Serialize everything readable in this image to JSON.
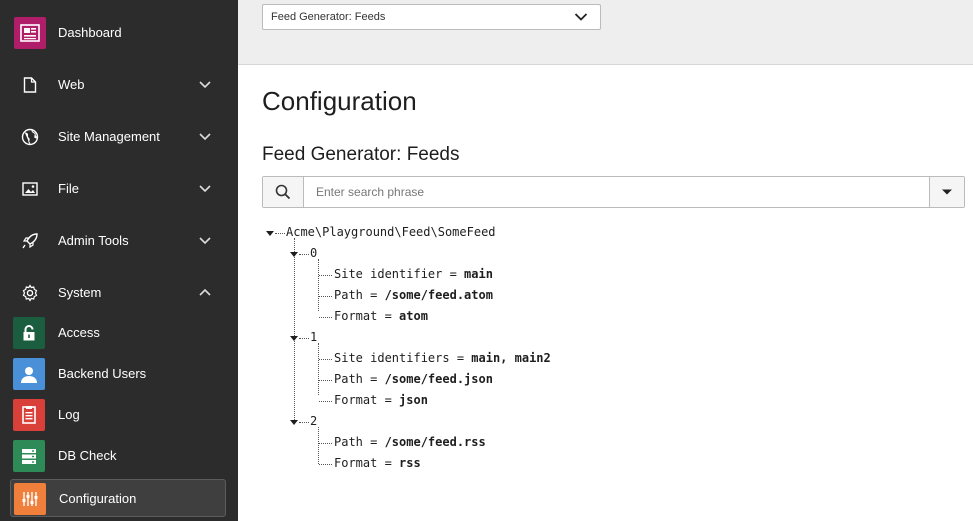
{
  "sidebar": {
    "items": [
      {
        "label": "Dashboard",
        "icon": "dashboard-icon"
      },
      {
        "label": "Web",
        "icon": "page-icon"
      },
      {
        "label": "Site Management",
        "icon": "globe-icon"
      },
      {
        "label": "File",
        "icon": "image-icon"
      },
      {
        "label": "Admin Tools",
        "icon": "rocket-icon"
      },
      {
        "label": "System",
        "icon": "gear-icon"
      }
    ],
    "system_items": [
      {
        "label": "Access",
        "icon": "lock-icon",
        "color": "#1b5e3f"
      },
      {
        "label": "Backend Users",
        "icon": "user-icon",
        "color": "#4a90d9"
      },
      {
        "label": "Log",
        "icon": "log-icon",
        "color": "#d9403a"
      },
      {
        "label": "DB Check",
        "icon": "database-icon",
        "color": "#2e8b57"
      },
      {
        "label": "Configuration",
        "icon": "sliders-icon",
        "color": "#f07f3c"
      }
    ],
    "dashboard_color": "#b01e6a"
  },
  "topbar": {
    "module_select": "Feed Generator: Feeds"
  },
  "main": {
    "title": "Configuration",
    "subtitle": "Feed Generator: Feeds",
    "search_placeholder": "Enter search phrase"
  },
  "tree": {
    "root": "Acme\\Playground\\Feed\\SomeFeed",
    "nodes": [
      {
        "key": "0",
        "entries": [
          {
            "label": "Site identifier = ",
            "value": "main"
          },
          {
            "label": "Path = ",
            "value": "/some/feed.atom"
          },
          {
            "label": "Format = ",
            "value": "atom"
          }
        ]
      },
      {
        "key": "1",
        "entries": [
          {
            "label": "Site identifiers = ",
            "value": "main, main2"
          },
          {
            "label": "Path = ",
            "value": "/some/feed.json"
          },
          {
            "label": "Format = ",
            "value": "json"
          }
        ]
      },
      {
        "key": "2",
        "entries": [
          {
            "label": "Path = ",
            "value": "/some/feed.rss"
          },
          {
            "label": "Format = ",
            "value": "rss"
          }
        ]
      }
    ]
  }
}
